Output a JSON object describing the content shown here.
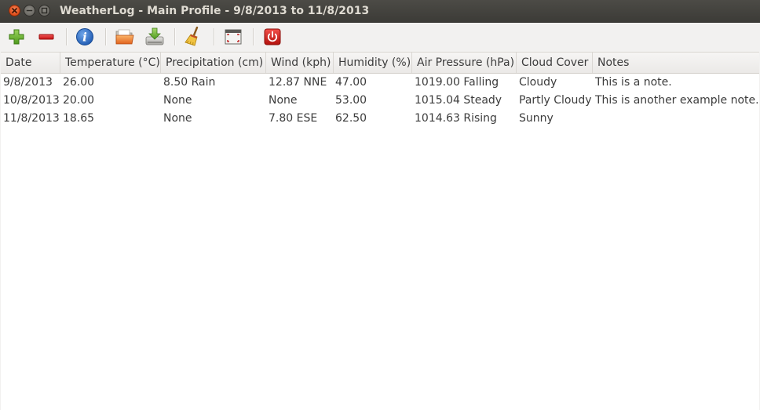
{
  "window": {
    "title": "WeatherLog - Main Profile - 9/8/2013 to 11/8/2013"
  },
  "toolbar": {
    "buttons": [
      {
        "icon": "add-icon"
      },
      {
        "icon": "remove-icon"
      },
      {
        "icon": "info-icon"
      },
      {
        "icon": "import-folder-icon"
      },
      {
        "icon": "export-download-icon"
      },
      {
        "icon": "clear-broom-icon"
      },
      {
        "icon": "fullscreen-icon"
      },
      {
        "icon": "exit-power-icon"
      }
    ]
  },
  "table": {
    "columns": [
      "Date",
      "Temperature (°C)",
      "Precipitation (cm)",
      "Wind (kph)",
      "Humidity (%)",
      "Air Pressure (hPa)",
      "Cloud Cover",
      "Notes"
    ],
    "rows": [
      [
        "9/8/2013",
        "26.00",
        "8.50 Rain",
        "12.87 NNE",
        "47.00",
        "1019.00 Falling",
        "Cloudy",
        "This is a note."
      ],
      [
        "10/8/2013",
        "20.00",
        "None",
        "None",
        "53.00",
        "1015.04 Steady",
        "Partly Cloudy",
        "This is another example note."
      ],
      [
        "11/8/2013",
        "18.65",
        "None",
        "7.80 ESE",
        "62.50",
        "1014.63 Rising",
        "Sunny",
        ""
      ]
    ]
  },
  "colors": {
    "titlebar": "#3c3b37",
    "close_button": "#df4a16",
    "add_green": "#5aa829",
    "remove_red": "#d81c1c",
    "info_blue": "#2a6fc9"
  }
}
